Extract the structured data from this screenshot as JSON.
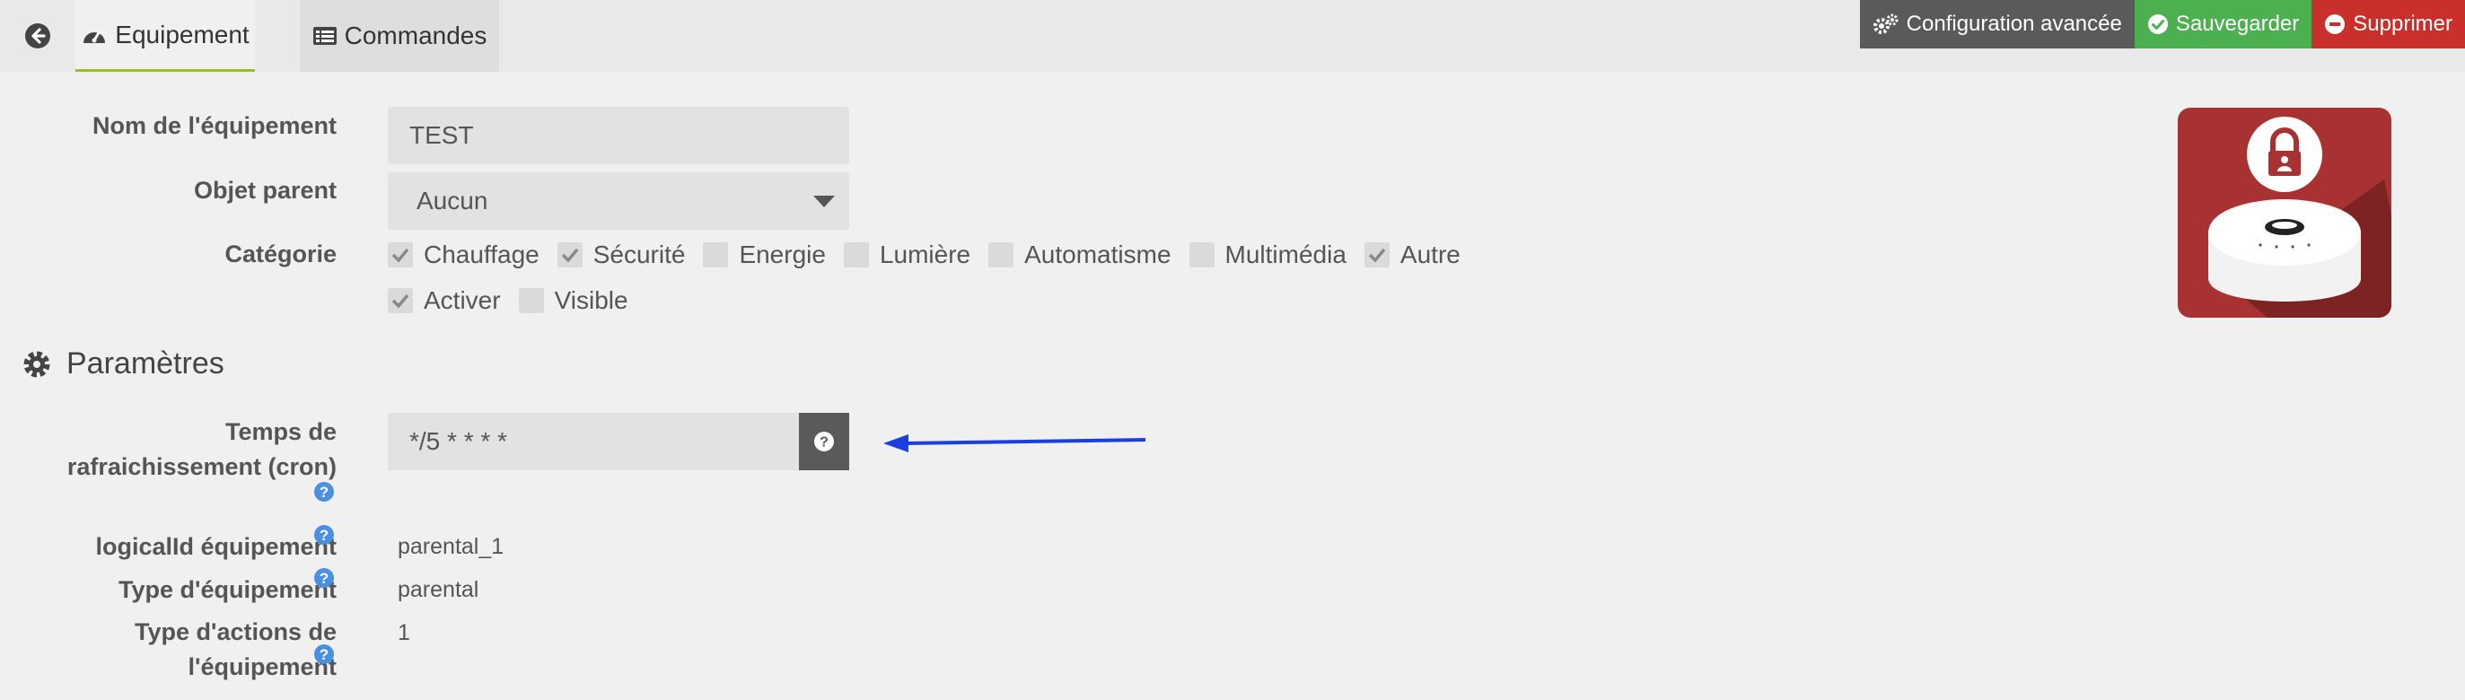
{
  "tabs": {
    "equipement": "Equipement",
    "commandes": "Commandes"
  },
  "actions": {
    "config": "Configuration avancée",
    "save": "Sauvegarder",
    "delete": "Supprimer"
  },
  "form": {
    "name_label": "Nom de l'équipement",
    "name_value": "TEST",
    "parent_label": "Objet parent",
    "parent_value": "Aucun",
    "category_label": "Catégorie",
    "categories": [
      {
        "label": "Chauffage",
        "checked": true
      },
      {
        "label": "Sécurité",
        "checked": true
      },
      {
        "label": "Energie",
        "checked": false
      },
      {
        "label": "Lumière",
        "checked": false
      },
      {
        "label": "Automatisme",
        "checked": false
      },
      {
        "label": "Multimédia",
        "checked": false
      },
      {
        "label": "Autre",
        "checked": true
      }
    ],
    "activer": {
      "label": "Activer",
      "checked": true
    },
    "visible": {
      "label": "Visible",
      "checked": false
    }
  },
  "params": {
    "title": "Paramètres",
    "cron_label_1": "Temps de",
    "cron_label_2": "rafraichissement (cron)",
    "cron_value": "*/5 * * * *",
    "logical_label": "logicalId équipement",
    "logical_value": "parental_1",
    "type_label": "Type d'équipement",
    "type_value": "parental",
    "actions_label_1": "Type d'actions de",
    "actions_label_2": "l'équipement",
    "actions_value": "1"
  },
  "colors": {
    "accent": "#94c11f",
    "save": "#4caf50",
    "delete": "#c9302c",
    "arrow": "#1a3fe0",
    "help": "#4a90e2"
  }
}
